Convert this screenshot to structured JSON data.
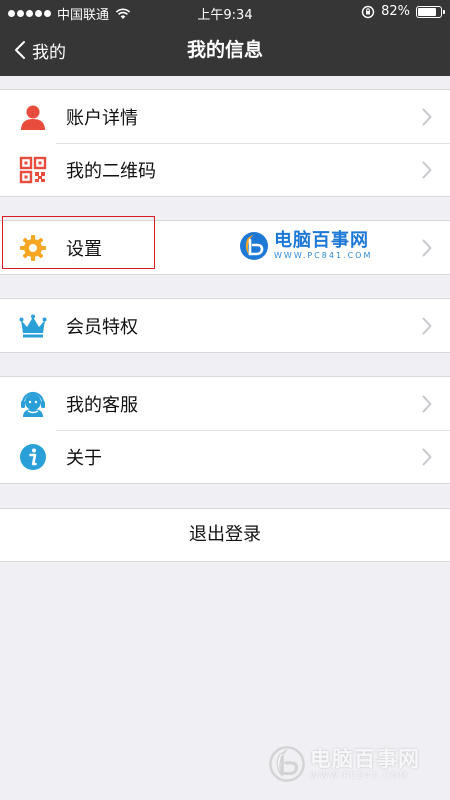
{
  "status_bar": {
    "carrier": "中国联通",
    "time": "上午9:34",
    "battery": "82%",
    "battery_level": 0.82,
    "icons": [
      "signal-dots-icon",
      "wifi-icon",
      "orientation-lock-icon",
      "battery-icon"
    ]
  },
  "nav": {
    "back_label": "我的",
    "title": "我的信息",
    "back_icon": "chevron-left-icon"
  },
  "groups": [
    {
      "items": [
        {
          "label": "账户详情",
          "icon": "person-icon",
          "color": "#e84c3d"
        },
        {
          "label": "我的二维码",
          "icon": "qr-code-icon",
          "color": "#e84c3d"
        }
      ]
    },
    {
      "items": [
        {
          "label": "设置",
          "icon": "gear-icon",
          "color": "#f5a623",
          "highlighted": true
        }
      ]
    },
    {
      "items": [
        {
          "label": "会员特权",
          "icon": "crown-icon",
          "color": "#2a9fd8"
        }
      ]
    },
    {
      "items": [
        {
          "label": "我的客服",
          "icon": "customer-service-icon",
          "color": "#2a9fd8"
        },
        {
          "label": "关于",
          "icon": "info-icon",
          "color": "#2a9fd8"
        }
      ]
    }
  ],
  "logout_label": "退出登录",
  "watermark": {
    "title": "电脑百事网",
    "url": "WWW.PC841.COM",
    "bottom_title": "电脑百事网",
    "bottom_url": "WWW.PC841.COM"
  },
  "colors": {
    "header_bg": "#363636",
    "page_bg": "#efeff4",
    "highlight_border": "#d61c24",
    "chevron": "#c7c7cc"
  }
}
